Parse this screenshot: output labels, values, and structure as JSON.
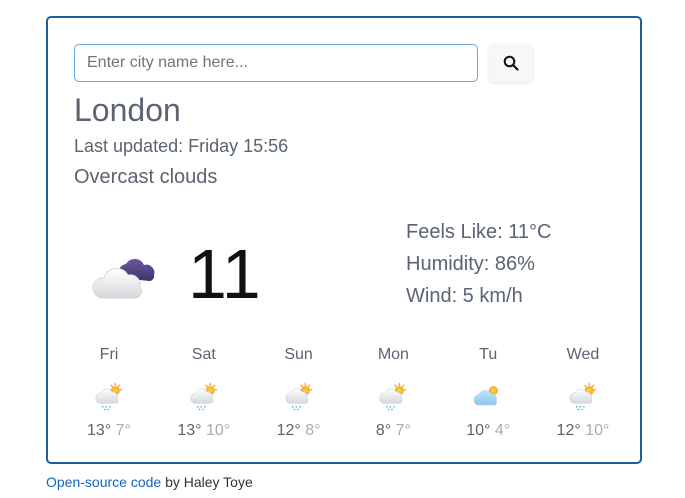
{
  "search": {
    "placeholder": "Enter city name here...",
    "button_icon": "search-icon"
  },
  "weather": {
    "city": "London",
    "last_updated": "Last updated: Friday 15:56",
    "description": "Overcast clouds",
    "icon": "overcast-clouds-icon",
    "temperature": "11",
    "feels_like": "Feels Like: 11°C",
    "humidity": "Humidity: 86%",
    "wind": "Wind: 5 km/h"
  },
  "forecast": [
    {
      "day": "Fri",
      "icon": "sun-cloud-rain-icon",
      "max": "13°",
      "min": "7°"
    },
    {
      "day": "Sat",
      "icon": "sun-cloud-rain-icon",
      "max": "13°",
      "min": "10°"
    },
    {
      "day": "Sun",
      "icon": "sun-cloud-rain-icon",
      "max": "12°",
      "min": "8°"
    },
    {
      "day": "Mon",
      "icon": "sun-cloud-rain-icon",
      "max": "8°",
      "min": "7°"
    },
    {
      "day": "Tu",
      "icon": "sun-cloud-icon",
      "max": "10°",
      "min": "4°"
    },
    {
      "day": "Wed",
      "icon": "sun-cloud-rain-icon",
      "max": "12°",
      "min": "10°"
    }
  ],
  "footer": {
    "link_text": "Open-source code",
    "suffix": " by Haley Toye"
  },
  "colors": {
    "border": "#1f5f98",
    "link": "#1565c0",
    "text": "#5a6472",
    "min_temp": "#a6acb3"
  }
}
